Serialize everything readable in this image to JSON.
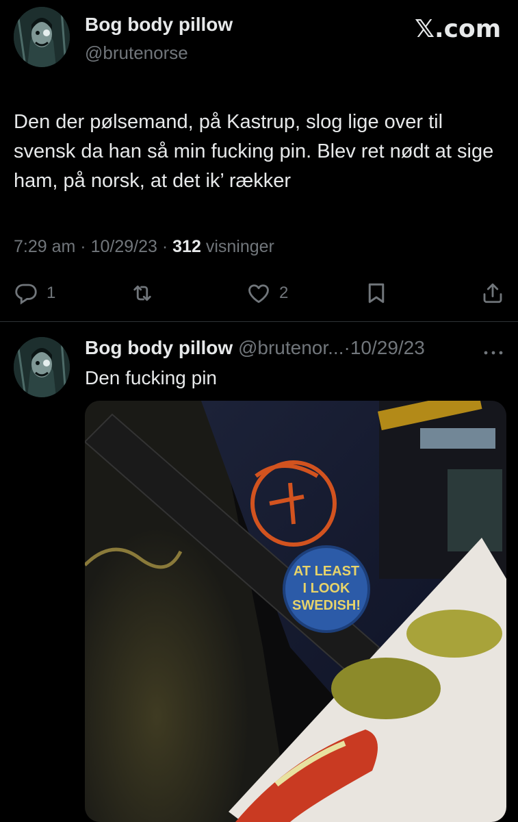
{
  "tweet": {
    "author_name": "Bog body pillow",
    "author_handle": "@brutenorse",
    "site_logo": "𝕏.com",
    "text": "Den der pølsemand, på Kastrup, slog lige over til svensk da han så min fucking pin. Blev ret nødt at sige ham, på norsk, at det ik’ rækker",
    "time": "7:29 am",
    "date": "10/29/23",
    "views_count": "312",
    "views_label": "visninger",
    "separator": "·",
    "actions": {
      "reply_icon": "reply-icon",
      "reply_count": "1",
      "retweet_icon": "retweet-icon",
      "like_icon": "heart-icon",
      "like_count": "2",
      "bookmark_icon": "bookmark-icon",
      "share_icon": "share-icon"
    }
  },
  "reply": {
    "author_name": "Bog body pillow",
    "author_handle": "@brutenor...",
    "separator": "·",
    "date": "10/29/23",
    "more_icon": "more-icon",
    "text": "Den fucking pin",
    "photo": {
      "description_icon": "photo",
      "pin_text": "AT LEAST I LOOK SWEDISH!"
    }
  },
  "colors": {
    "background": "#000000",
    "text": "#e7e9ea",
    "muted": "#71767b",
    "divider": "#2f3336"
  }
}
